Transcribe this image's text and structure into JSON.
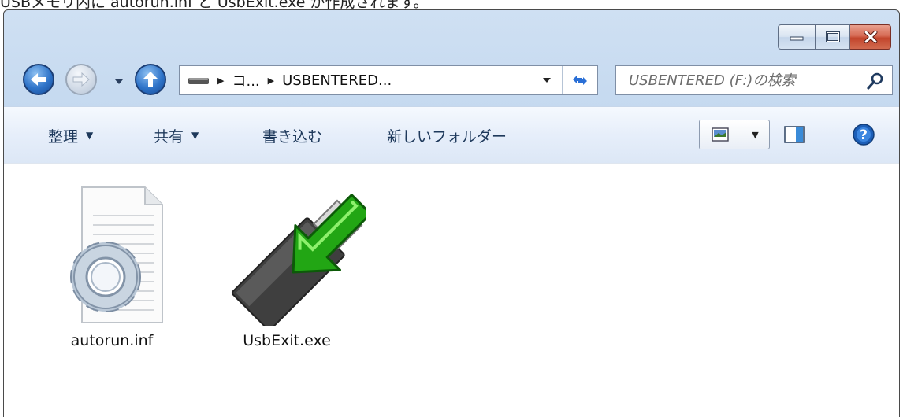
{
  "caption": {
    "text": "USBメモリ内に autorun.inf と UsbExit.exe が作成されます。"
  },
  "window": {
    "controls": {
      "minimize": "minimize",
      "maximize": "maximize",
      "close": "close"
    }
  },
  "navigation": {
    "back_icon": "back-arrow-icon",
    "forward_icon": "forward-arrow-icon",
    "up_icon": "up-arrow-icon",
    "breadcrumbs": [
      {
        "label": ""
      },
      {
        "label": "コ..."
      },
      {
        "label": "USBENTERED..."
      }
    ],
    "search": {
      "placeholder": "USBENTERED (F:)の検索"
    }
  },
  "toolbar": {
    "organize_label": "整理",
    "share_label": "共有",
    "burn_label": "書き込む",
    "new_folder_label": "新しいフォルダー"
  },
  "files": [
    {
      "name": "autorun.inf",
      "icon": "settings-file-icon"
    },
    {
      "name": "UsbExit.exe",
      "icon": "usb-exit-icon"
    }
  ],
  "colors": {
    "toolbar_text": "#1e395b",
    "window_frame": "#bcd3ec",
    "close_button": "#c2452c",
    "usb_arrow": "#22a614"
  }
}
